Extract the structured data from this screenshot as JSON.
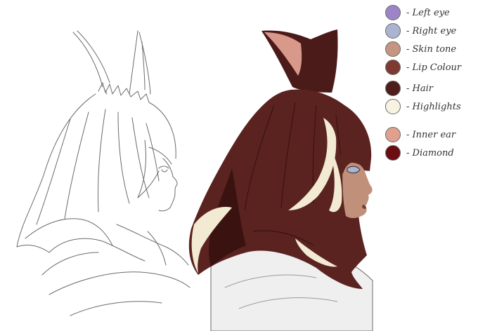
{
  "palette": [
    {
      "label": "- Left eye",
      "color": "#9c85c6"
    },
    {
      "label": "- Right eye",
      "color": "#aab3cf"
    },
    {
      "label": "- Skin tone",
      "color": "#c49580"
    },
    {
      "label": "- Lip Colour",
      "color": "#7c3a31"
    },
    {
      "label": "- Hair",
      "color": "#4f1d1a"
    },
    {
      "label": "- Highlights",
      "color": "#f8f3e1"
    },
    {
      "label": "- Inner ear",
      "color": "#dfa08e"
    },
    {
      "label": "- Diamond",
      "color": "#6b0d12"
    }
  ],
  "colors": {
    "hair": "#5a2320",
    "hair_dark": "#3a1310",
    "highlight": "#f3ead3",
    "skin": "#c0907a",
    "inner_ear": "#d8988a",
    "line": "#6b6b6b",
    "shawl": "#efefef"
  }
}
